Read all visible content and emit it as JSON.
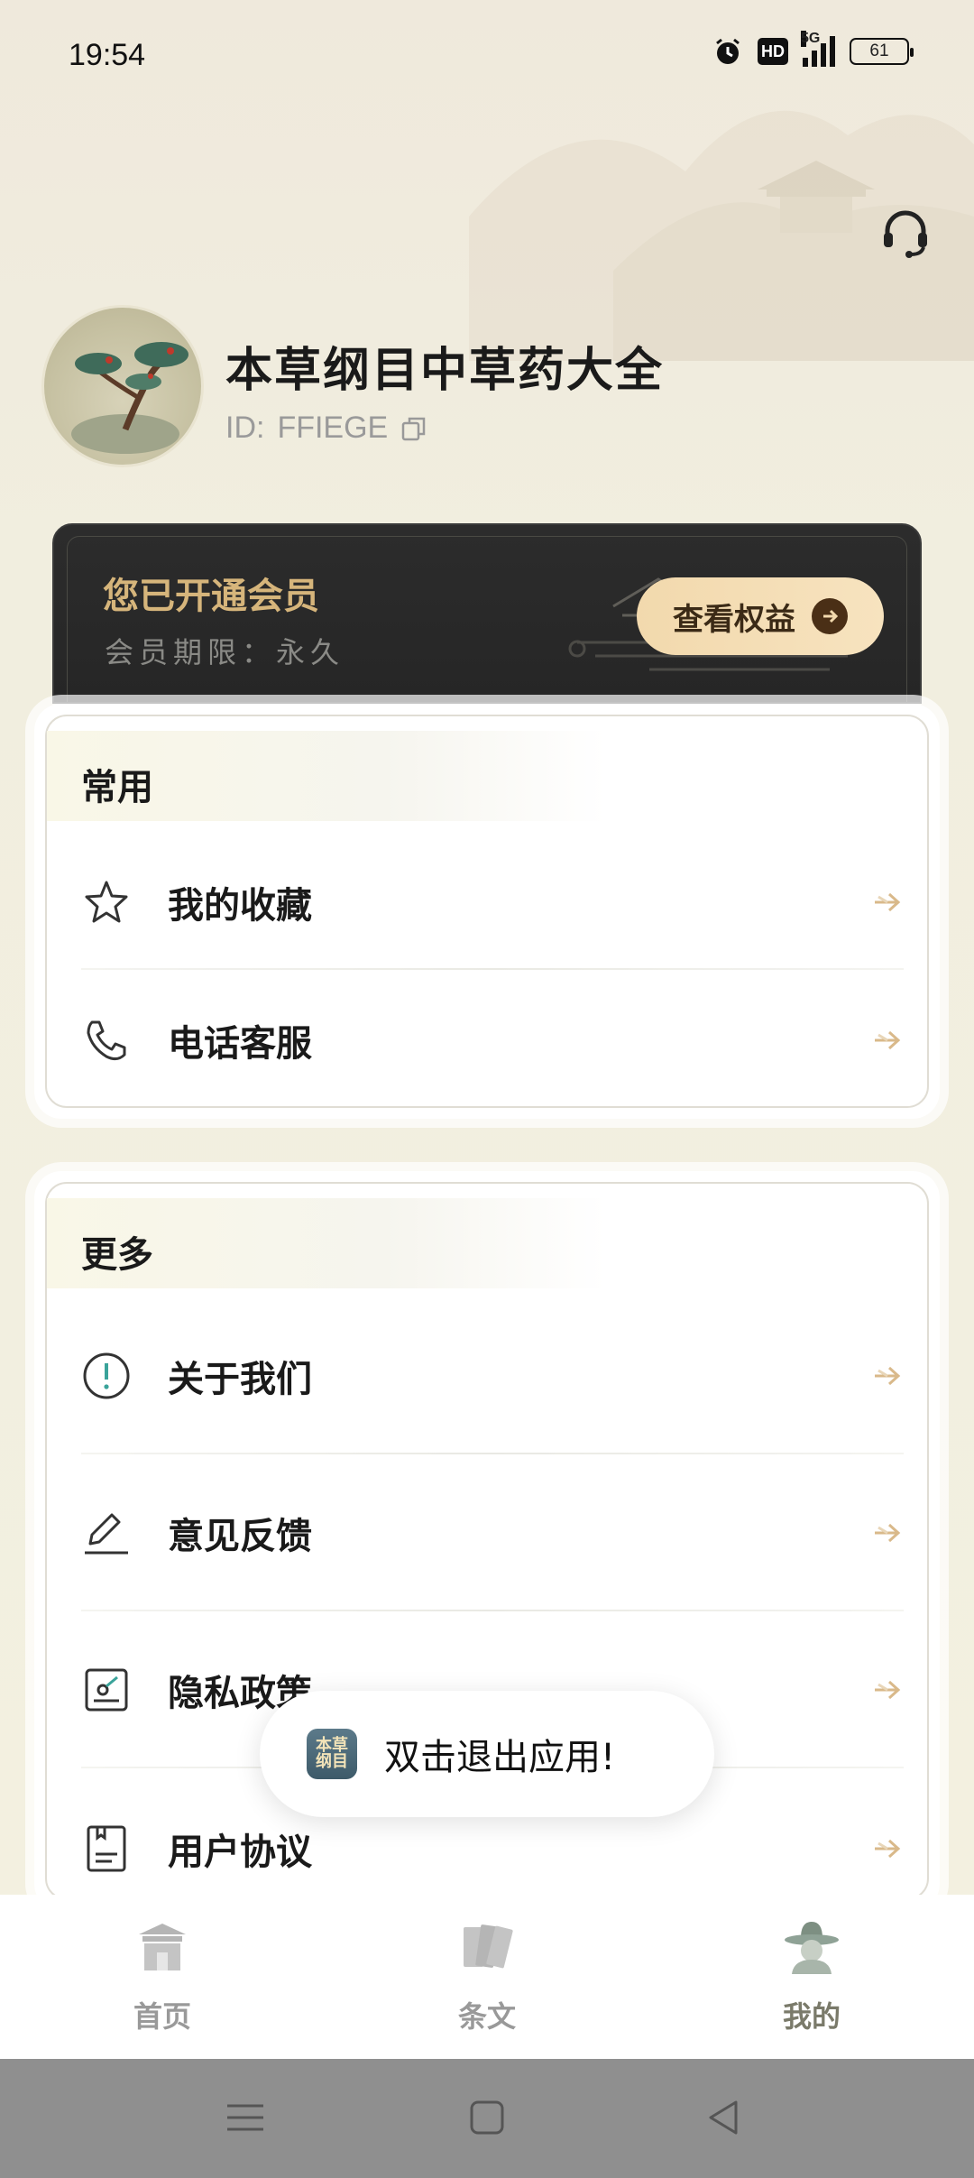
{
  "status_bar": {
    "time": "19:54",
    "hd": "HD",
    "network": "5G",
    "battery": "61"
  },
  "header": {
    "support_icon": "headset-icon"
  },
  "profile": {
    "name": "本草纲目中草药大全",
    "id_label": "ID:",
    "id_value": "FFIEGE"
  },
  "vip": {
    "title": "您已开通会员",
    "subtitle": "会员期限：永久",
    "button_label": "查看权益"
  },
  "sections": {
    "common": {
      "title": "常用",
      "items": [
        {
          "label": "我的收藏",
          "icon": "star-icon"
        },
        {
          "label": "电话客服",
          "icon": "phone-icon"
        }
      ]
    },
    "more": {
      "title": "更多",
      "items": [
        {
          "label": "关于我们",
          "icon": "info-icon"
        },
        {
          "label": "意见反馈",
          "icon": "edit-icon"
        },
        {
          "label": "隐私政策",
          "icon": "privacy-icon"
        },
        {
          "label": "用户协议",
          "icon": "agreement-icon"
        }
      ]
    }
  },
  "toast": {
    "message": "双击退出应用!",
    "app_icon_text": "本草纲目"
  },
  "bottom_nav": {
    "tabs": [
      {
        "label": "首页",
        "icon": "home-icon",
        "active": false
      },
      {
        "label": "条文",
        "icon": "text-icon",
        "active": false
      },
      {
        "label": "我的",
        "icon": "profile-icon",
        "active": true
      }
    ]
  },
  "colors": {
    "accent_gold": "#d6b57b",
    "vip_bg": "#2a2a2a",
    "arrow": "#d9b98a",
    "page_bg": "#f2efdf"
  }
}
